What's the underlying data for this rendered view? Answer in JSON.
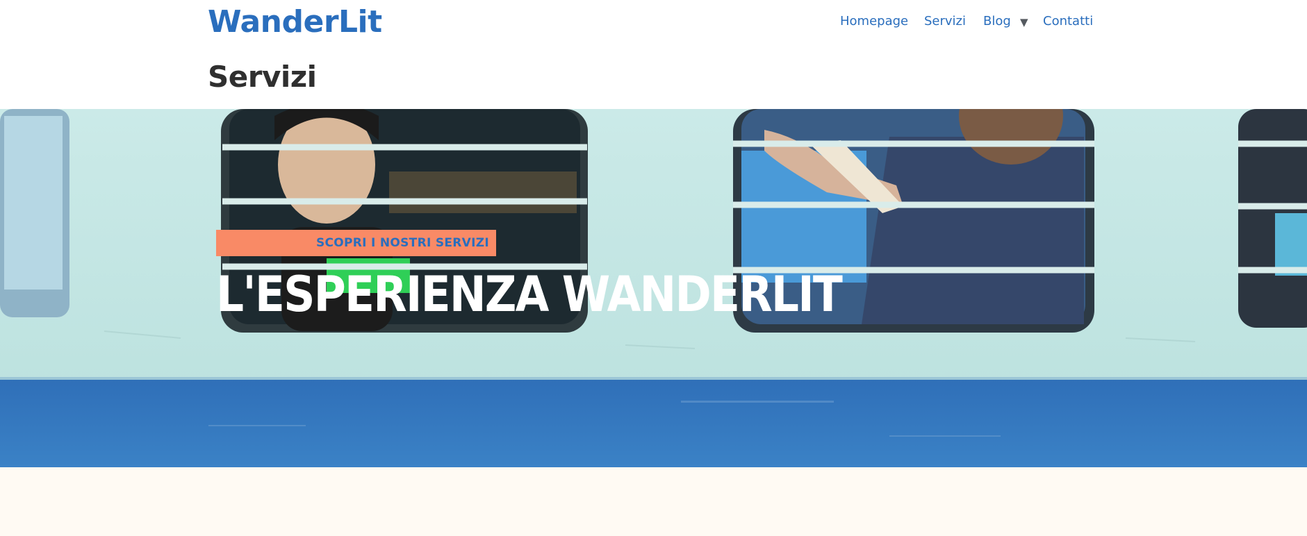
{
  "site": {
    "logo": "WanderLit"
  },
  "nav": {
    "items": [
      {
        "label": "Homepage"
      },
      {
        "label": "Servizi"
      },
      {
        "label": "Blog"
      },
      {
        "label": "Contatti"
      }
    ],
    "blog_caret_icon": "caret-down-icon"
  },
  "page": {
    "title": "Servizi"
  },
  "hero": {
    "badge": "SCOPRI I NOSTRI SERVIZI",
    "title": "L'ESPERIENZA WANDERLIT",
    "image_subject": "train-windows-photo"
  },
  "colors": {
    "accent": "#2a6ebd",
    "badge": "#f98a66",
    "title_text": "#2f2f2f",
    "hero_text": "#ffffff",
    "section_bg": "#fffaf3"
  }
}
